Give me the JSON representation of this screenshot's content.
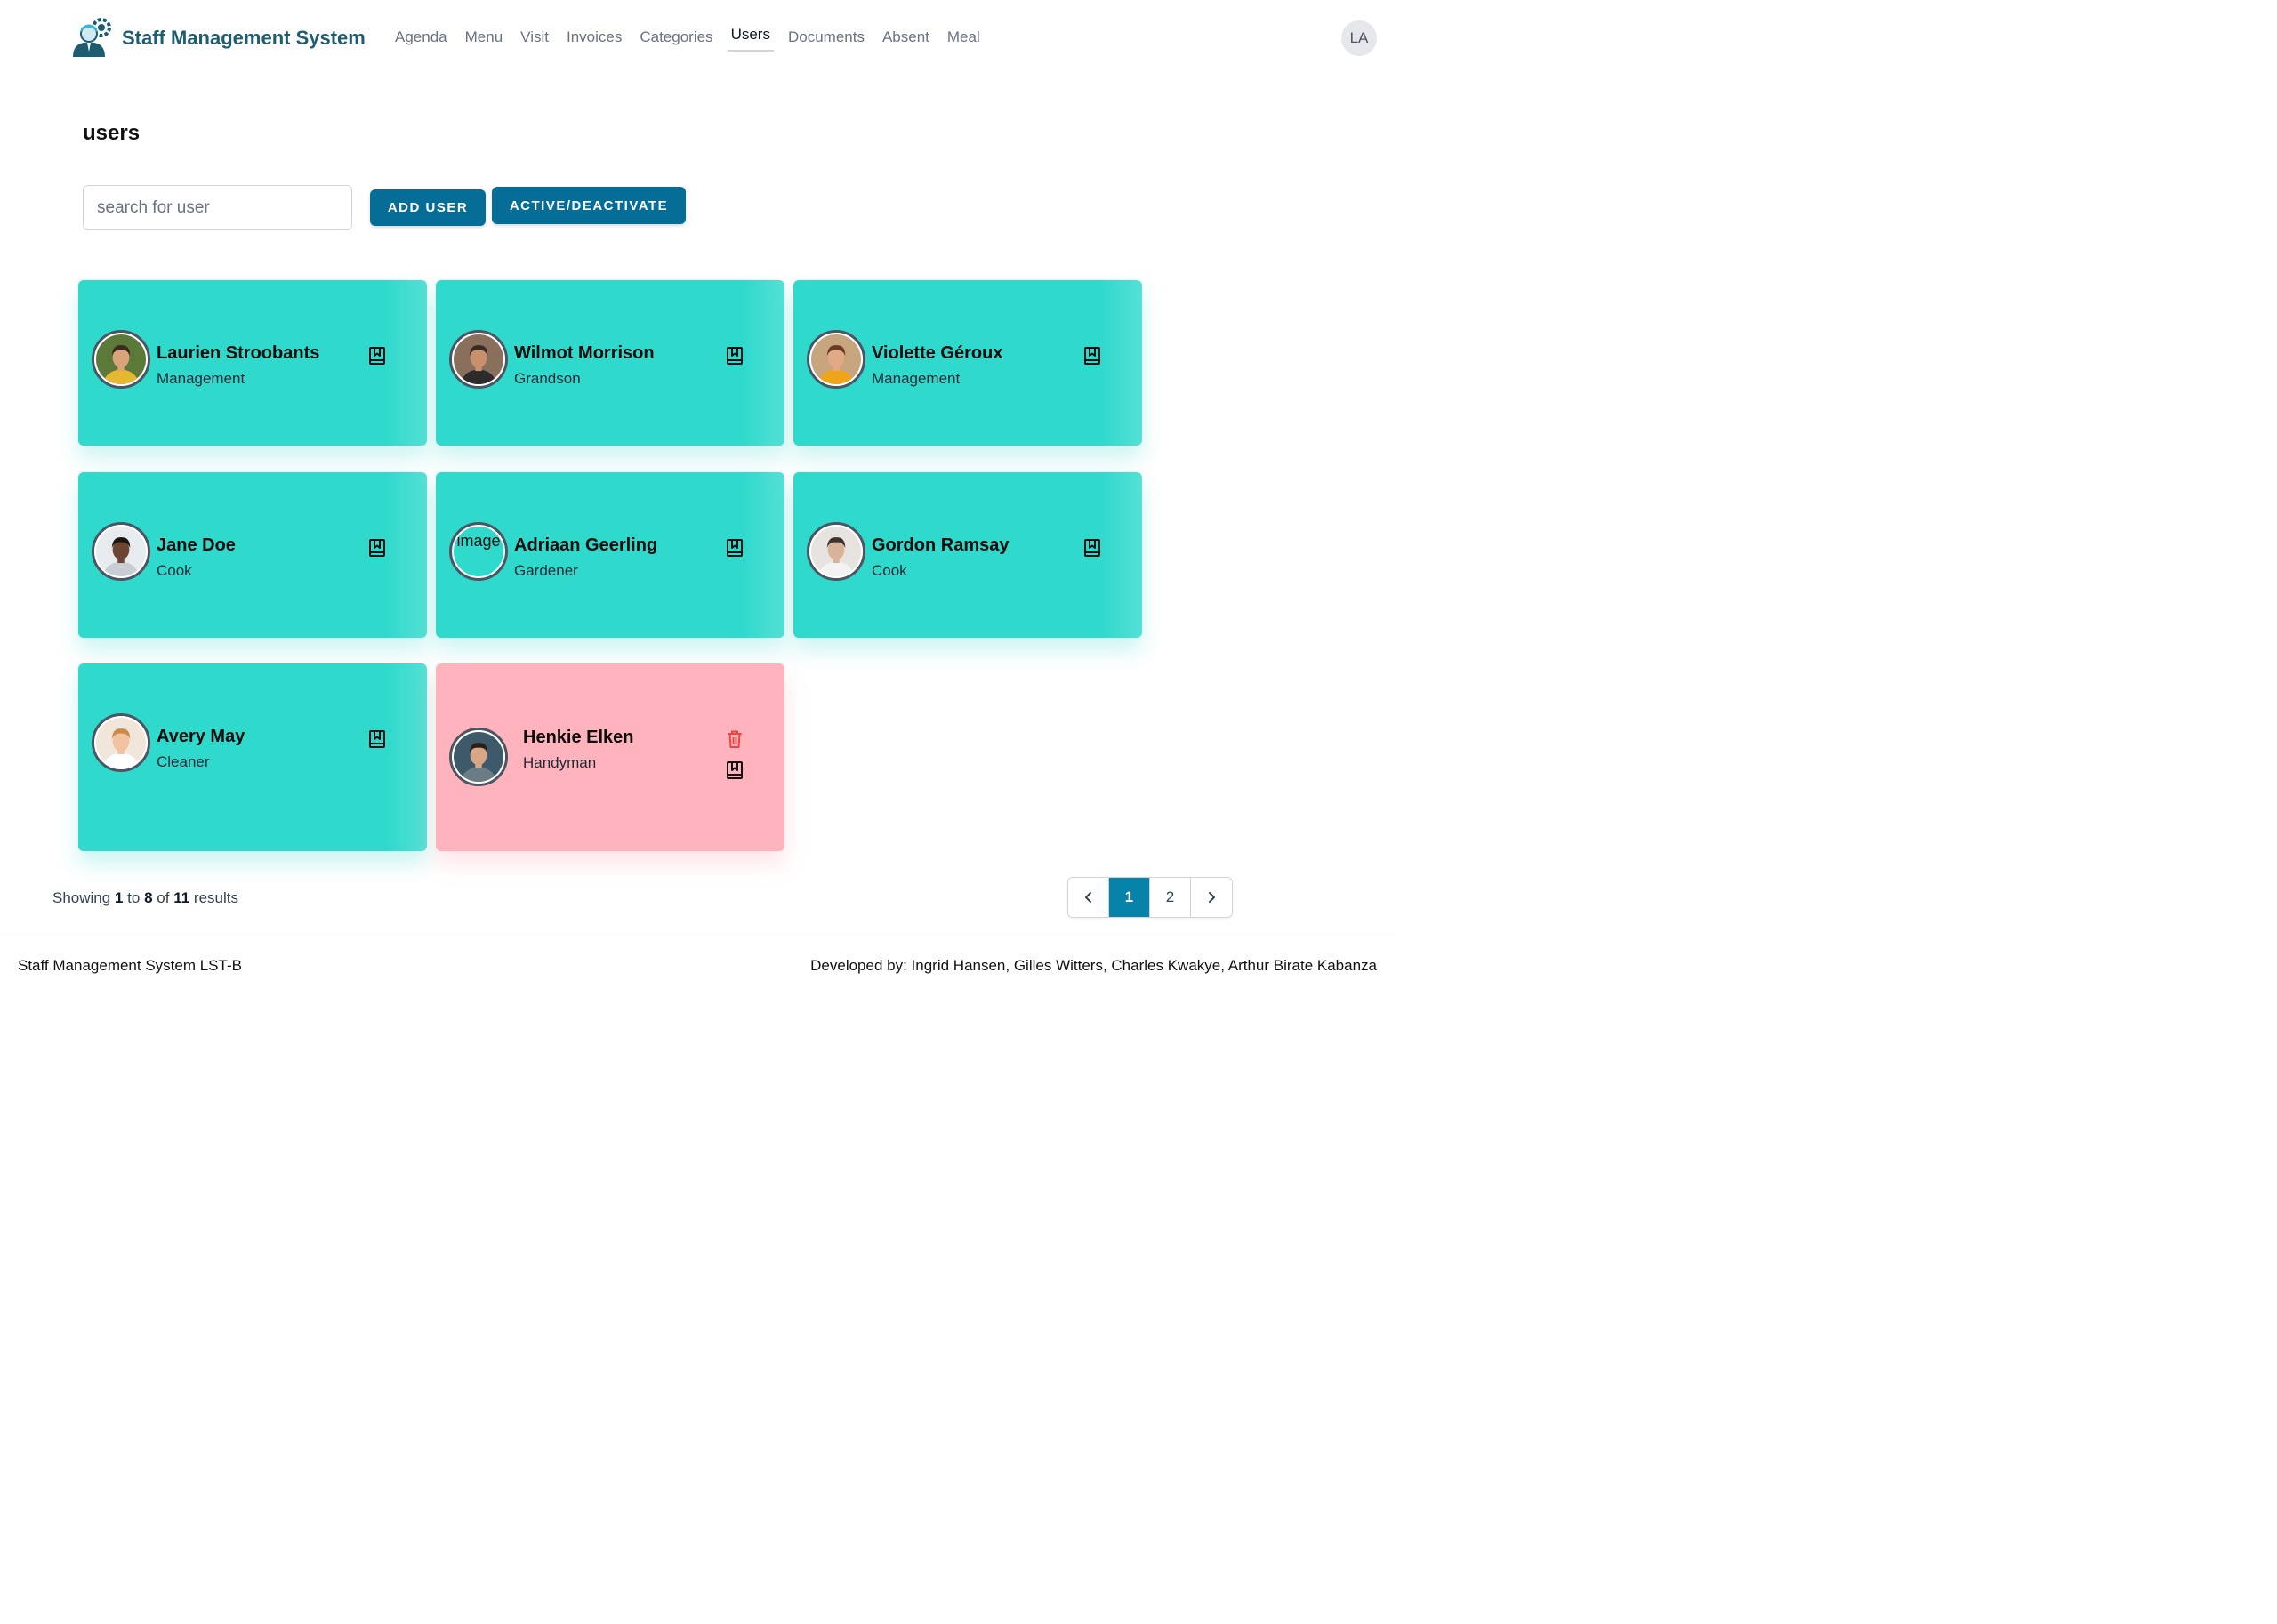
{
  "header": {
    "brand": "Staff Management System",
    "nav": [
      {
        "label": "Agenda"
      },
      {
        "label": "Menu"
      },
      {
        "label": "Visit"
      },
      {
        "label": "Invoices"
      },
      {
        "label": "Categories"
      },
      {
        "label": "Users",
        "active": true
      },
      {
        "label": "Documents"
      },
      {
        "label": "Absent"
      },
      {
        "label": "Meal"
      }
    ],
    "user_initials": "LA"
  },
  "page": {
    "title": "users",
    "search_placeholder": "search for user",
    "add_user_label": "ADD USER",
    "toggle_label": "ACTIVE/DEACTIVATE"
  },
  "users": [
    {
      "name": "Laurien Stroobants",
      "role": "Management",
      "active": true,
      "avatar": "photo-man-glasses"
    },
    {
      "name": "Wilmot Morrison",
      "role": "Grandson",
      "active": true,
      "avatar": "photo-man-beard"
    },
    {
      "name": "Violette Géroux",
      "role": "Management",
      "active": true,
      "avatar": "photo-woman-curly"
    },
    {
      "name": "Jane Doe",
      "role": "Cook",
      "active": true,
      "avatar": "photo-woman-afro"
    },
    {
      "name": "Adriaan Geerling",
      "role": "Gardener",
      "active": true,
      "avatar": "broken-image",
      "avatar_alt": "image"
    },
    {
      "name": "Gordon Ramsay",
      "role": "Cook",
      "active": true,
      "avatar": "photo-man-glasses-beard"
    },
    {
      "name": "Avery May",
      "role": "Cleaner",
      "active": true,
      "avatar": "photo-woman-blonde"
    },
    {
      "name": "Henkie Elken",
      "role": "Handyman",
      "active": false,
      "avatar": "photo-man-young"
    }
  ],
  "pagination": {
    "prefix": "Showing",
    "from": "1",
    "to_word": "to",
    "to": "8",
    "of_word": "of",
    "total": "11",
    "suffix": "results",
    "pages": [
      "1",
      "2"
    ],
    "current": "1"
  },
  "footer": {
    "left": "Staff Management System LST-B",
    "right": "Developed by: Ingrid Hansen, Gilles Witters, Charles Kwakye, Arthur Birate Kabanza"
  },
  "colors": {
    "brand": "#1e5c70",
    "button": "#066e96",
    "card_active": "#2fd9cc",
    "card_inactive": "#ffb3bd",
    "delete_icon": "#ef4444",
    "page_current": "#0783a9"
  }
}
